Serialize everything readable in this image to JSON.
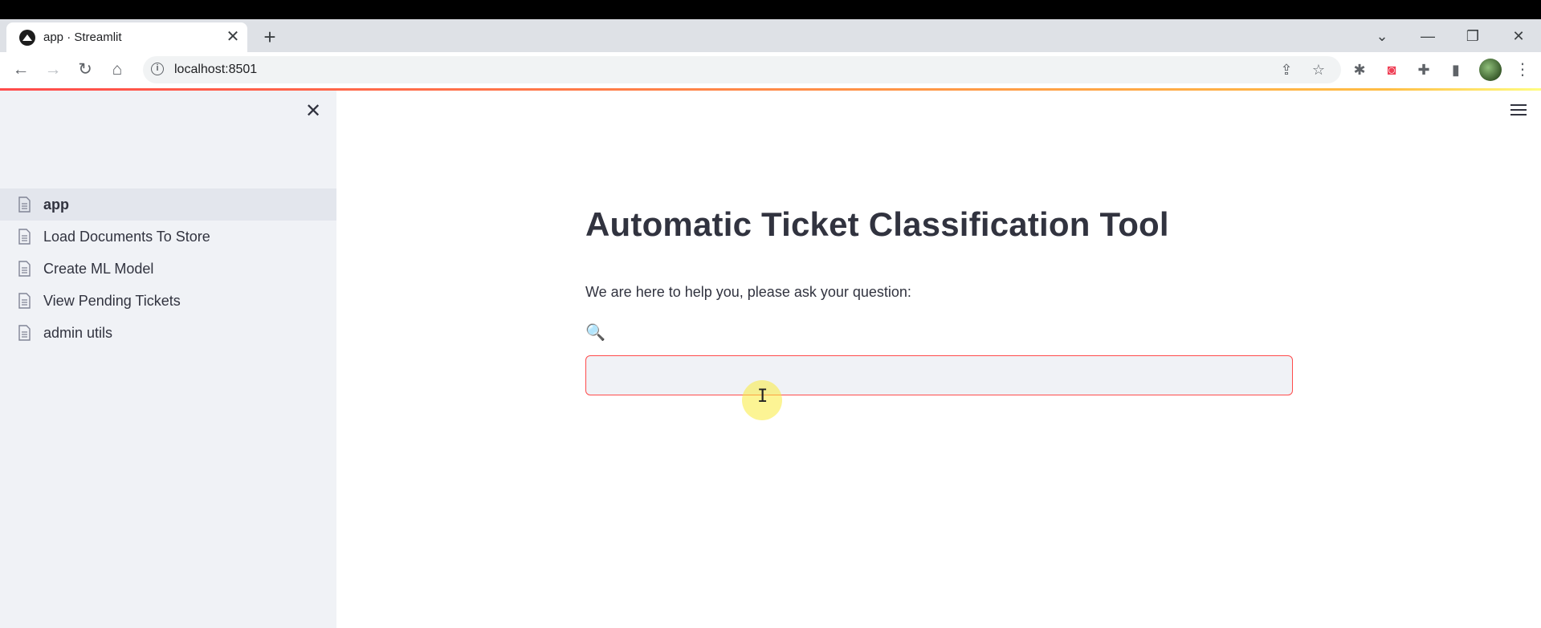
{
  "browser": {
    "tab_title": "app · Streamlit",
    "tab_close": "✕",
    "new_tab": "+",
    "window_controls": [
      "⌄",
      "—",
      "❐",
      "✕"
    ],
    "url": "localhost:8501",
    "nav": {
      "back": "←",
      "forward": "→",
      "reload": "↻",
      "home": "⌂"
    },
    "omnibox_icons": [
      "share-icon",
      "bookmark-star-icon"
    ],
    "extensions": [
      "ladybug-extension-icon",
      "pocket-icon",
      "puzzle-extensions-icon",
      "side-panel-icon"
    ],
    "menu": "⋮"
  },
  "sidebar": {
    "close": "✕",
    "items": [
      {
        "label": "app",
        "active": true
      },
      {
        "label": "Load Documents To Store",
        "active": false
      },
      {
        "label": "Create ML Model",
        "active": false
      },
      {
        "label": "View Pending Tickets",
        "active": false
      },
      {
        "label": "admin utils",
        "active": false
      }
    ]
  },
  "main": {
    "title": "Automatic Ticket Classification Tool",
    "subtitle": "We are here to help you, please ask your question:",
    "input_label": "🔍",
    "input_value": ""
  },
  "colors": {
    "accent": "#ff4b4b",
    "sidebar_bg": "#f0f2f6",
    "text": "#31333f"
  }
}
